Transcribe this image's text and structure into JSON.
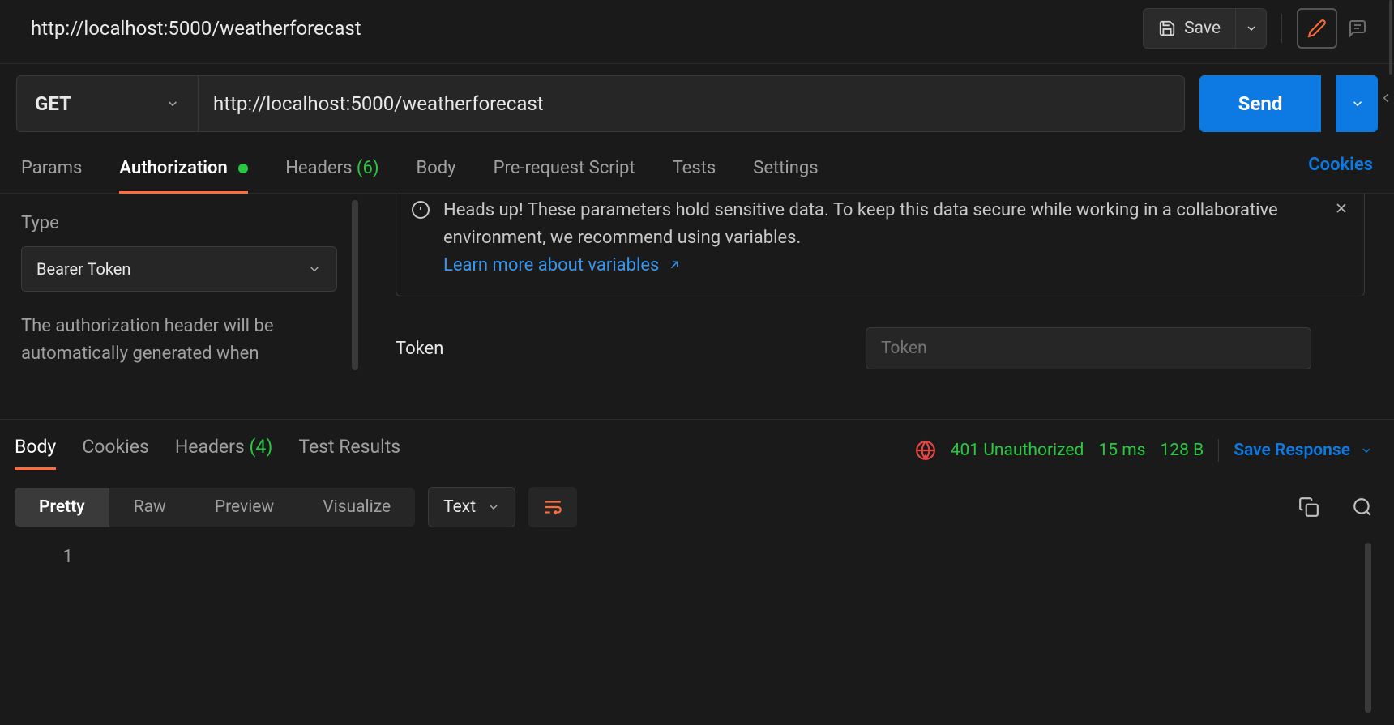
{
  "header": {
    "title": "http://localhost:5000/weatherforecast",
    "save_label": "Save"
  },
  "request": {
    "method": "GET",
    "url": "http://localhost:5000/weatherforecast",
    "send_label": "Send"
  },
  "request_tabs": {
    "params": "Params",
    "authorization": "Authorization",
    "headers": "Headers",
    "headers_count": "(6)",
    "body": "Body",
    "pre_request": "Pre-request Script",
    "tests": "Tests",
    "settings": "Settings",
    "cookies": "Cookies"
  },
  "auth": {
    "type_label": "Type",
    "type_value": "Bearer Token",
    "desc": "The authorization header will be automatically generated when",
    "notice": "Heads up! These parameters hold sensitive data. To keep this data secure while working in a collaborative environment, we recommend using variables.",
    "learn_more": "Learn more about variables",
    "token_label": "Token",
    "token_placeholder": "Token"
  },
  "response_tabs": {
    "body": "Body",
    "cookies": "Cookies",
    "headers": "Headers",
    "headers_count": "(4)",
    "test_results": "Test Results"
  },
  "response_status": {
    "status": "401 Unauthorized",
    "time": "15 ms",
    "size": "128 B",
    "save_response": "Save Response"
  },
  "body_toolbar": {
    "pretty": "Pretty",
    "raw": "Raw",
    "preview": "Preview",
    "visualize": "Visualize",
    "content_type": "Text"
  },
  "body_lines": {
    "num1": "1"
  }
}
